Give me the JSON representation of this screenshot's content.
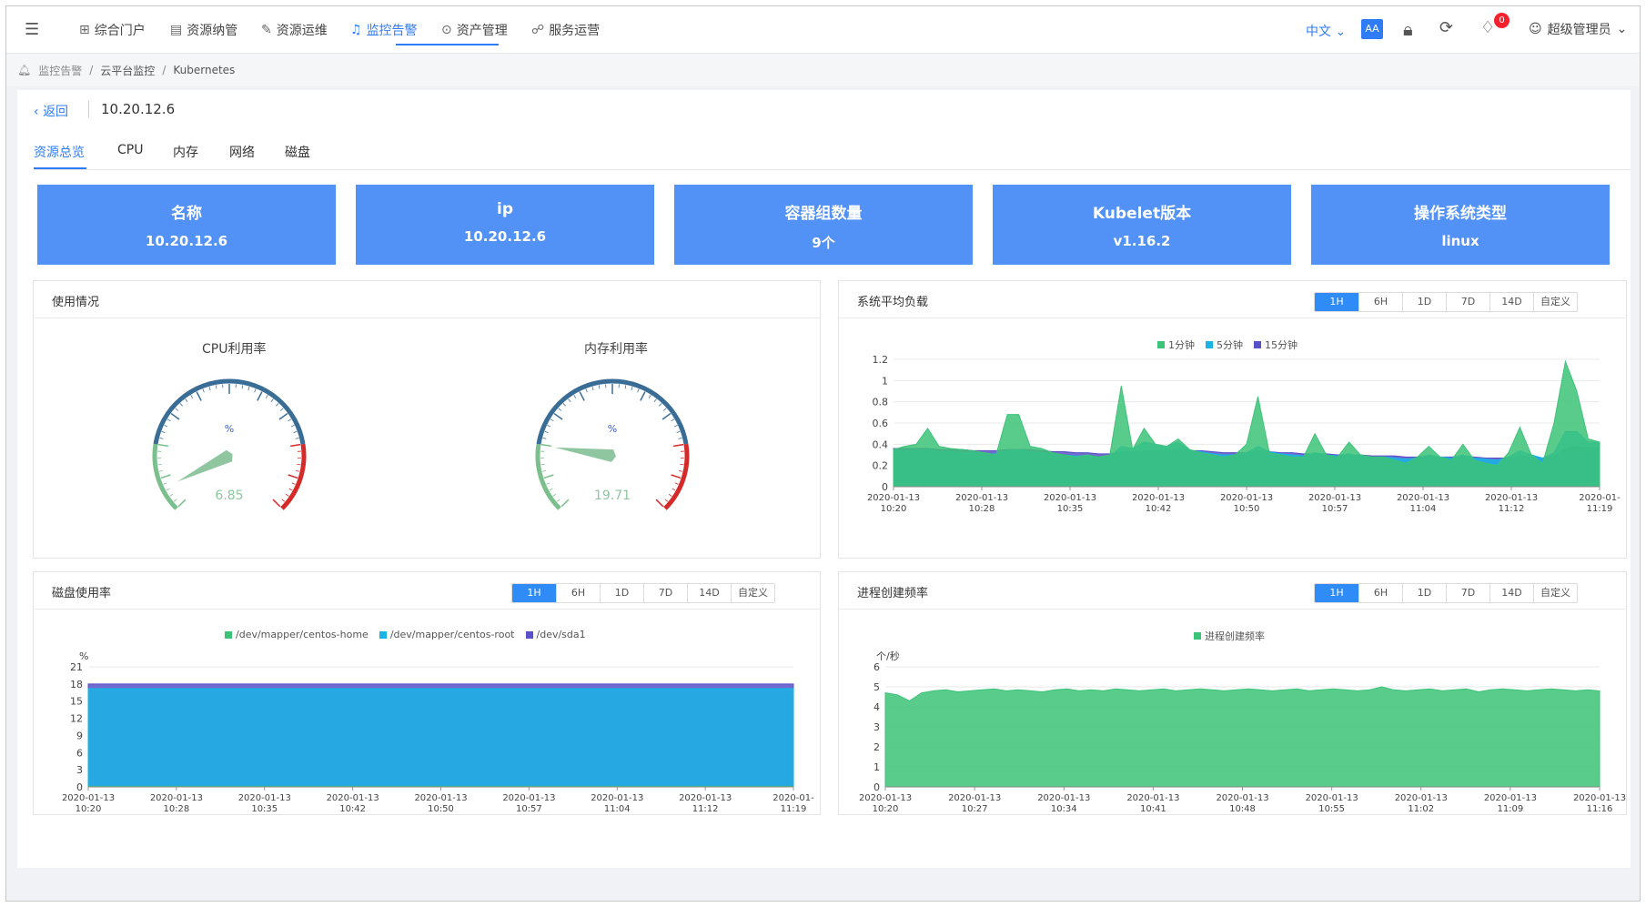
{
  "nav": {
    "items": [
      {
        "icon": "grid-icon",
        "glyph": "⊞",
        "label": "综合门户"
      },
      {
        "icon": "server-icon",
        "glyph": "▤",
        "label": "资源纳管"
      },
      {
        "icon": "wrench-icon",
        "glyph": "✎",
        "label": "资源运维"
      },
      {
        "icon": "bell-icon",
        "glyph": "♫",
        "label": "监控告警"
      },
      {
        "icon": "box-icon",
        "glyph": "⊙",
        "label": "资产管理"
      },
      {
        "icon": "org-icon",
        "glyph": "☍",
        "label": "服务运营"
      }
    ],
    "active_index": 3,
    "lang": "中文",
    "font_toggle": "AA",
    "notification_count": "0",
    "user": "超级管理员"
  },
  "breadcrumb": [
    "监控告警",
    "云平台监控",
    "Kubernetes"
  ],
  "page": {
    "back_label": "返回",
    "title": "10.20.12.6",
    "tabs": [
      "资源总览",
      "CPU",
      "内存",
      "网络",
      "磁盘"
    ],
    "active_tab": 0
  },
  "cards": [
    {
      "key": "名称",
      "value": "10.20.12.6"
    },
    {
      "key": "ip",
      "value": "10.20.12.6"
    },
    {
      "key": "容器组数量",
      "value": "9个"
    },
    {
      "key": "Kubelet版本",
      "value": "v1.16.2"
    },
    {
      "key": "操作系统类型",
      "value": "linux"
    }
  ],
  "range_buttons": [
    "1H",
    "6H",
    "1D",
    "7D",
    "14D",
    "自定义"
  ],
  "colors": {
    "accent": "#2f7cf6",
    "card": "#5291f5",
    "green": "#3cc378",
    "cyan": "#19b4e6",
    "purple": "#5a50c8",
    "gauge_green": "#7bbf8c",
    "gauge_red": "#d42a2a"
  },
  "usage_panel": {
    "title": "使用情况",
    "gauges": [
      {
        "title": "CPU利用率",
        "unit": "%",
        "value": 6.85,
        "value_label": "6.85"
      },
      {
        "title": "内存利用率",
        "unit": "%",
        "value": 19.71,
        "value_label": "19.71"
      }
    ]
  },
  "chart_data": [
    {
      "type": "area",
      "title": "系统平均负载",
      "legend_position": "top",
      "ylim": [
        0,
        1.2
      ],
      "y_ticks": [
        "0",
        "0.2",
        "0.4",
        "0.6",
        "0.8",
        "1",
        "1.2"
      ],
      "x_ticks": [
        [
          "2020-01-13",
          "10:20"
        ],
        [
          "2020-01-13",
          "10:28"
        ],
        [
          "2020-01-13",
          "10:35"
        ],
        [
          "2020-01-13",
          "10:42"
        ],
        [
          "2020-01-13",
          "10:50"
        ],
        [
          "2020-01-13",
          "10:57"
        ],
        [
          "2020-01-13",
          "11:04"
        ],
        [
          "2020-01-13",
          "11:12"
        ],
        [
          "2020-01-",
          "11:19"
        ]
      ],
      "series": [
        {
          "name": "1分钟",
          "color": "#3cc378",
          "values": [
            0.35,
            0.38,
            0.4,
            0.55,
            0.38,
            0.36,
            0.35,
            0.34,
            0.32,
            0.3,
            0.68,
            0.68,
            0.38,
            0.36,
            0.32,
            0.3,
            0.28,
            0.3,
            0.28,
            0.3,
            0.95,
            0.35,
            0.55,
            0.4,
            0.38,
            0.45,
            0.35,
            0.32,
            0.3,
            0.28,
            0.3,
            0.4,
            0.85,
            0.32,
            0.3,
            0.28,
            0.28,
            0.5,
            0.3,
            0.28,
            0.42,
            0.3,
            0.28,
            0.28,
            0.25,
            0.22,
            0.28,
            0.38,
            0.28,
            0.25,
            0.4,
            0.25,
            0.22,
            0.2,
            0.32,
            0.56,
            0.3,
            0.22,
            0.6,
            1.18,
            0.9,
            0.45,
            0.42
          ]
        },
        {
          "name": "5分钟",
          "color": "#19b4e6",
          "values": [
            0.34,
            0.34,
            0.34,
            0.35,
            0.33,
            0.33,
            0.32,
            0.32,
            0.31,
            0.31,
            0.34,
            0.35,
            0.33,
            0.32,
            0.31,
            0.3,
            0.29,
            0.29,
            0.28,
            0.28,
            0.38,
            0.36,
            0.42,
            0.4,
            0.38,
            0.42,
            0.34,
            0.33,
            0.31,
            0.3,
            0.3,
            0.32,
            0.38,
            0.33,
            0.31,
            0.3,
            0.29,
            0.32,
            0.3,
            0.29,
            0.31,
            0.29,
            0.28,
            0.28,
            0.27,
            0.26,
            0.27,
            0.3,
            0.28,
            0.27,
            0.3,
            0.27,
            0.26,
            0.25,
            0.28,
            0.34,
            0.3,
            0.27,
            0.32,
            0.52,
            0.52,
            0.42,
            0.42
          ]
        },
        {
          "name": "15分钟",
          "color": "#5a50c8",
          "values": [
            0.36,
            0.36,
            0.36,
            0.36,
            0.35,
            0.35,
            0.35,
            0.34,
            0.34,
            0.34,
            0.35,
            0.35,
            0.35,
            0.34,
            0.33,
            0.33,
            0.32,
            0.32,
            0.31,
            0.31,
            0.33,
            0.33,
            0.34,
            0.34,
            0.34,
            0.35,
            0.34,
            0.34,
            0.33,
            0.32,
            0.32,
            0.32,
            0.34,
            0.33,
            0.32,
            0.32,
            0.31,
            0.31,
            0.31,
            0.3,
            0.3,
            0.3,
            0.29,
            0.29,
            0.29,
            0.28,
            0.28,
            0.29,
            0.28,
            0.28,
            0.29,
            0.28,
            0.27,
            0.27,
            0.27,
            0.29,
            0.28,
            0.27,
            0.29,
            0.36,
            0.38,
            0.37,
            0.37
          ]
        }
      ]
    },
    {
      "type": "area",
      "title": "磁盘使用率",
      "ylabel": "%",
      "legend_position": "top",
      "ylim": [
        0,
        21
      ],
      "y_ticks": [
        "0",
        "3",
        "6",
        "9",
        "12",
        "15",
        "18",
        "21"
      ],
      "x_ticks": [
        [
          "2020-01-13",
          "10:20"
        ],
        [
          "2020-01-13",
          "10:28"
        ],
        [
          "2020-01-13",
          "10:35"
        ],
        [
          "2020-01-13",
          "10:42"
        ],
        [
          "2020-01-13",
          "10:50"
        ],
        [
          "2020-01-13",
          "10:57"
        ],
        [
          "2020-01-13",
          "11:04"
        ],
        [
          "2020-01-13",
          "11:12"
        ],
        [
          "2020-01-",
          "11:19"
        ]
      ],
      "series": [
        {
          "name": "/dev/mapper/centos-home",
          "color": "#3cc378",
          "values": [
            0.1,
            0.1,
            0.1,
            0.1,
            0.1,
            0.1,
            0.1,
            0.1,
            0.1
          ]
        },
        {
          "name": "/dev/mapper/centos-root",
          "color": "#19b4e6",
          "values": [
            17.2,
            17.2,
            17.2,
            17.2,
            17.2,
            17.2,
            17.2,
            17.2,
            17.2
          ]
        },
        {
          "name": "/dev/sda1",
          "color": "#5a50c8",
          "values": [
            18.0,
            18.0,
            18.0,
            18.0,
            18.0,
            18.0,
            18.0,
            18.0,
            18.0
          ]
        }
      ]
    },
    {
      "type": "area",
      "title": "进程创建频率",
      "ylabel": "个/秒",
      "legend_position": "top",
      "ylim": [
        0,
        6
      ],
      "y_ticks": [
        "0",
        "1",
        "2",
        "3",
        "4",
        "5",
        "6"
      ],
      "x_ticks": [
        [
          "2020-01-13",
          "10:20"
        ],
        [
          "2020-01-13",
          "10:27"
        ],
        [
          "2020-01-13",
          "10:34"
        ],
        [
          "2020-01-13",
          "10:41"
        ],
        [
          "2020-01-13",
          "10:48"
        ],
        [
          "2020-01-13",
          "10:55"
        ],
        [
          "2020-01-13",
          "11:02"
        ],
        [
          "2020-01-13",
          "11:09"
        ],
        [
          "2020-01-13",
          "11:16"
        ]
      ],
      "series": [
        {
          "name": "进程创建频率",
          "color": "#3cc378",
          "values": [
            4.7,
            4.6,
            4.3,
            4.7,
            4.8,
            4.85,
            4.75,
            4.8,
            4.85,
            4.9,
            4.8,
            4.85,
            4.8,
            4.75,
            4.85,
            4.9,
            4.8,
            4.85,
            4.8,
            4.9,
            4.85,
            4.8,
            4.85,
            4.9,
            4.8,
            4.85,
            4.9,
            4.85,
            4.8,
            4.85,
            4.9,
            4.85,
            4.8,
            4.85,
            4.9,
            4.8,
            4.85,
            4.9,
            4.85,
            4.8,
            4.85,
            5.0,
            4.85,
            4.8,
            4.85,
            4.9,
            4.8,
            4.85,
            4.9,
            4.75,
            4.85,
            4.9,
            4.85,
            4.8,
            4.85,
            4.9,
            4.85,
            4.8,
            4.85,
            4.8
          ]
        }
      ]
    }
  ]
}
